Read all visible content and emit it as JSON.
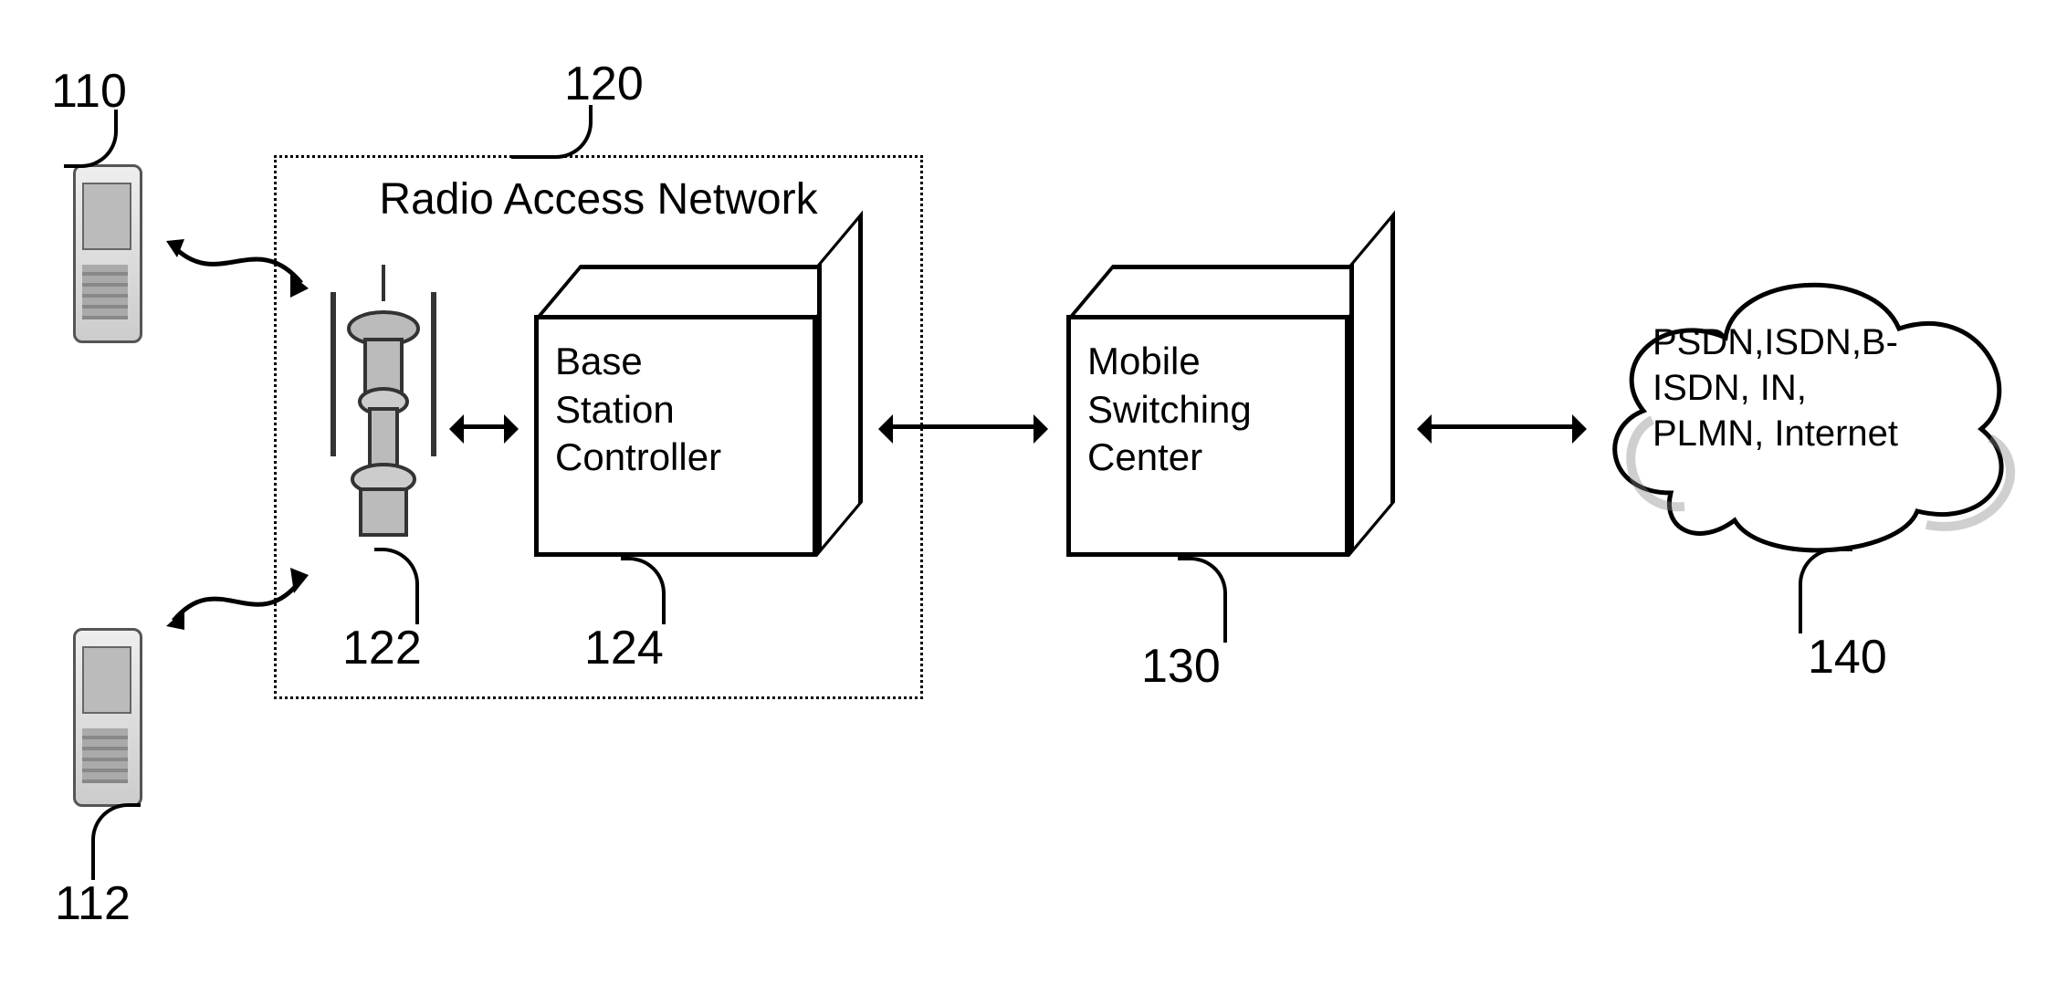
{
  "labels": {
    "n110": "110",
    "n112": "112",
    "n120": "120",
    "n122": "122",
    "n124": "124",
    "n130": "130",
    "n140": "140"
  },
  "ran": {
    "title": "Radio Access Network",
    "bsc": "Base\nStation\nController"
  },
  "msc": "Mobile\nSwitching\nCenter",
  "cloud": "PSDN,ISDN,B-\nISDN, IN,\nPLMN, Internet"
}
